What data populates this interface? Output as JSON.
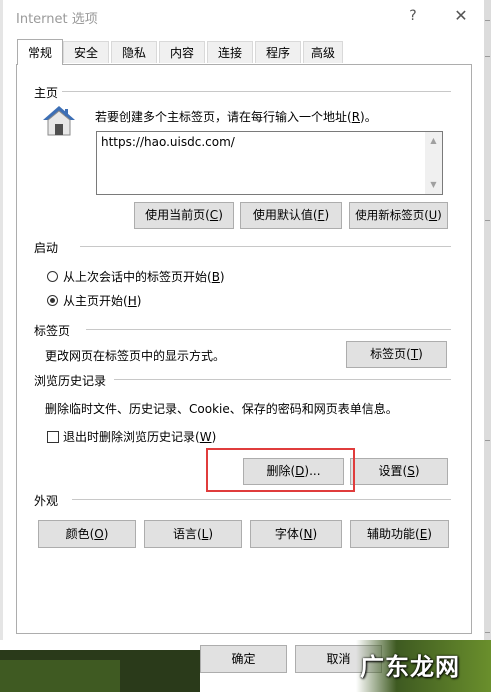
{
  "window": {
    "title": "Internet 选项",
    "help_glyph": "?",
    "close_glyph": "✕"
  },
  "tabs": [
    {
      "label": "常规",
      "active": true
    },
    {
      "label": "安全",
      "active": false
    },
    {
      "label": "隐私",
      "active": false
    },
    {
      "label": "内容",
      "active": false
    },
    {
      "label": "连接",
      "active": false
    },
    {
      "label": "程序",
      "active": false
    },
    {
      "label": "高级",
      "active": false
    }
  ],
  "homepage": {
    "section_title": "主页",
    "instruction_prefix": "若要创建多个主标签页，请在每行输入一个地址(",
    "instruction_key": "R",
    "instruction_suffix": ")。",
    "url_value": "https://hao.uisdc.com/",
    "buttons": {
      "use_current": {
        "prefix": "使用当前页(",
        "key": "C",
        "suffix": ")"
      },
      "use_default": {
        "prefix": "使用默认值(",
        "key": "F",
        "suffix": ")"
      },
      "use_new_tab": {
        "prefix": "使用新标签页(",
        "key": "U",
        "suffix": ")"
      }
    }
  },
  "startup": {
    "section_title": "启动",
    "options": [
      {
        "prefix": "从上次会话中的标签页开始(",
        "key": "B",
        "suffix": ")",
        "selected": false
      },
      {
        "prefix": "从主页开始(",
        "key": "H",
        "suffix": ")",
        "selected": true
      }
    ]
  },
  "tabs_section": {
    "section_title": "标签页",
    "description": "更改网页在标签页中的显示方式。",
    "button": {
      "prefix": "标签页(",
      "key": "T",
      "suffix": ")"
    }
  },
  "history": {
    "section_title": "浏览历史记录",
    "description": "删除临时文件、历史记录、Cookie、保存的密码和网页表单信息。",
    "checkbox": {
      "prefix": "退出时删除浏览历史记录(",
      "key": "W",
      "suffix": ")",
      "checked": false
    },
    "delete_button": {
      "prefix": "删除(",
      "key": "D",
      "suffix": ")..."
    },
    "settings_button": {
      "prefix": "设置(",
      "key": "S",
      "suffix": ")"
    }
  },
  "appearance": {
    "section_title": "外观",
    "buttons": [
      {
        "prefix": "颜色(",
        "key": "O",
        "suffix": ")"
      },
      {
        "prefix": "语言(",
        "key": "L",
        "suffix": ")"
      },
      {
        "prefix": "字体(",
        "key": "N",
        "suffix": ")"
      },
      {
        "prefix": "辅助功能(",
        "key": "E",
        "suffix": ")"
      }
    ]
  },
  "footer": {
    "ok_label": "确定",
    "cancel_label": "取消",
    "watermark": "广东龙网"
  },
  "colors": {
    "highlight_box": "#e03c3c",
    "button_face": "#e1e1e1",
    "house_roof": "#3d6fb5"
  },
  "icons": {
    "homepage": "house-icon"
  }
}
